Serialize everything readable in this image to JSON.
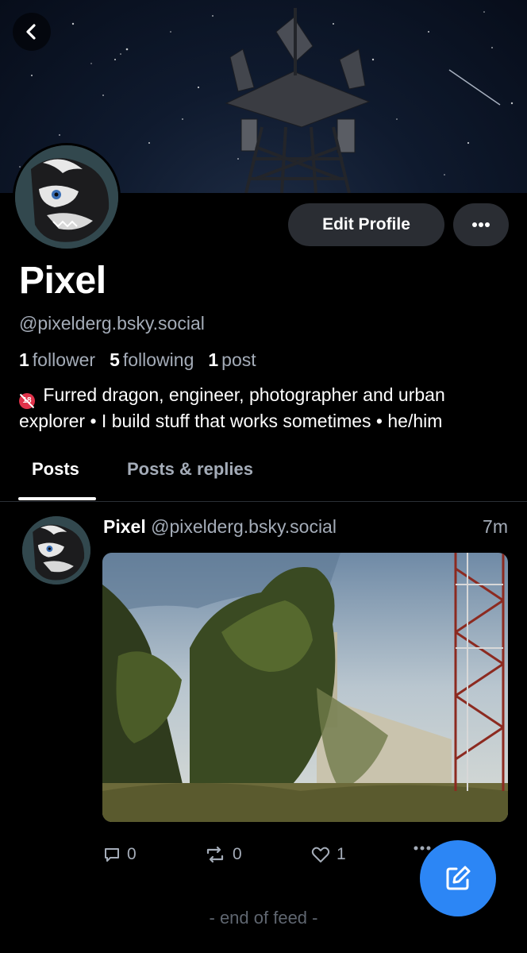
{
  "profile": {
    "display_name": "Pixel",
    "handle": "@pixelderg.bsky.social",
    "followers_count": "1",
    "followers_label": "follower",
    "following_count": "5",
    "following_label": "following",
    "posts_count": "1",
    "posts_label": "post",
    "bio": "Furred dragon, engineer, photographer and urban explorer • I build stuff that works sometimes • he/him",
    "bio_emoji": "18"
  },
  "buttons": {
    "edit_profile": "Edit Profile",
    "more_icon": "ellipsis-icon",
    "back_icon": "chevron-left-icon"
  },
  "tabs": [
    {
      "label": "Posts",
      "active": true
    },
    {
      "label": "Posts & replies",
      "active": false
    }
  ],
  "post": {
    "author_name": "Pixel",
    "author_handle": "@pixelderg.bsky.social",
    "time": "7m",
    "reply_count": "0",
    "repost_count": "0",
    "like_count": "1"
  },
  "feed_end": "- end of feed -",
  "colors": {
    "background": "#000000",
    "button_bg": "#2a2d33",
    "muted_text": "#a4acb8",
    "fab": "#2c86f5"
  }
}
